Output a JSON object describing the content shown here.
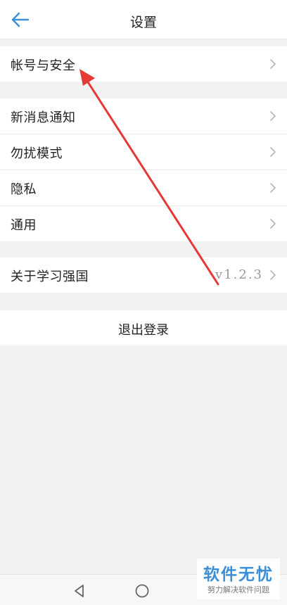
{
  "header": {
    "title": "设置",
    "back_icon": "arrow-left-icon",
    "accent_color": "#3a8fd8"
  },
  "settings": {
    "account_security": "帐号与安全",
    "new_message_notify": "新消息通知",
    "do_not_disturb": "勿扰模式",
    "privacy": "隐私",
    "general": "通用",
    "about": "关于学习强国",
    "version": "v1.2.3",
    "chevron_icon": "chevron-right-icon"
  },
  "logout": {
    "label": "退出登录"
  },
  "navbar": {
    "back_icon": "triangle-back-icon",
    "home_icon": "circle-home-icon"
  },
  "watermark": {
    "title": "软件无忧",
    "subtitle": "努力解决软件问题"
  },
  "annotation": {
    "arrow_color": "#e53935"
  }
}
